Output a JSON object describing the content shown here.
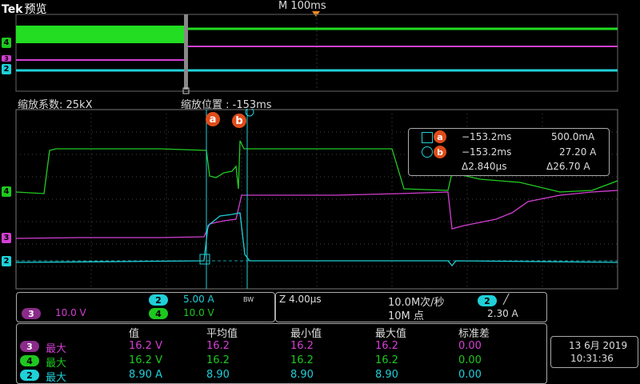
{
  "header": {
    "brand": "Tek",
    "mode": "预览",
    "timebase": "M 100ms"
  },
  "zoom": {
    "factor": "缩放系数: 25kX",
    "position": "缩放位置 : -153ms"
  },
  "channel_markers": [
    {
      "label": "4",
      "color": "#1ec81e"
    },
    {
      "label": "3",
      "color": "#d43fd4"
    },
    {
      "label": "2",
      "color": "#1fd0d8"
    }
  ],
  "cursors": {
    "a_label": "a",
    "b_label": "b"
  },
  "cursor_readout": {
    "a_time": "−153.2ms",
    "a_value": "500.0mA",
    "b_time": "−153.2ms",
    "b_value": "27.20 A",
    "delta_time": "Δ2.840μs",
    "delta_value": "Δ26.70 A"
  },
  "channel_settings": {
    "ch2": {
      "label": "2",
      "scale": "5.00 A",
      "color": "#1fd0d8"
    },
    "ch3": {
      "label": "3",
      "scale": "10.0 V",
      "color": "#d43fd4"
    },
    "ch4": {
      "label": "4",
      "scale": "10.0 V",
      "color": "#1ec81e"
    },
    "bw": "BW"
  },
  "horizontal": {
    "zoom_scale": "Z 4.00μs",
    "sample_rate": "10.0M次/秒",
    "record_length": "10M 点",
    "trigger_channel": "2",
    "trigger_slope": "╱",
    "trigger_level": "2.30 A"
  },
  "measurements": {
    "headers": [
      "值",
      "平均值",
      "最小值",
      "最大值",
      "标准差"
    ],
    "rows": [
      {
        "ch": "3",
        "name": "最大",
        "color": "#d43fd4",
        "values": [
          "16.2 V",
          "16.2",
          "16.2",
          "16.2",
          "0.00"
        ]
      },
      {
        "ch": "4",
        "name": "最大",
        "color": "#1ec81e",
        "values": [
          "16.2 V",
          "16.2",
          "16.2",
          "16.2",
          "0.00"
        ]
      },
      {
        "ch": "2",
        "name": "最大",
        "color": "#1fd0d8",
        "values": [
          "8.90 A",
          "8.90",
          "8.90",
          "8.90",
          "0.00"
        ]
      }
    ]
  },
  "datetime": {
    "date": "13 6月 2019",
    "time": "10:31:36"
  }
}
